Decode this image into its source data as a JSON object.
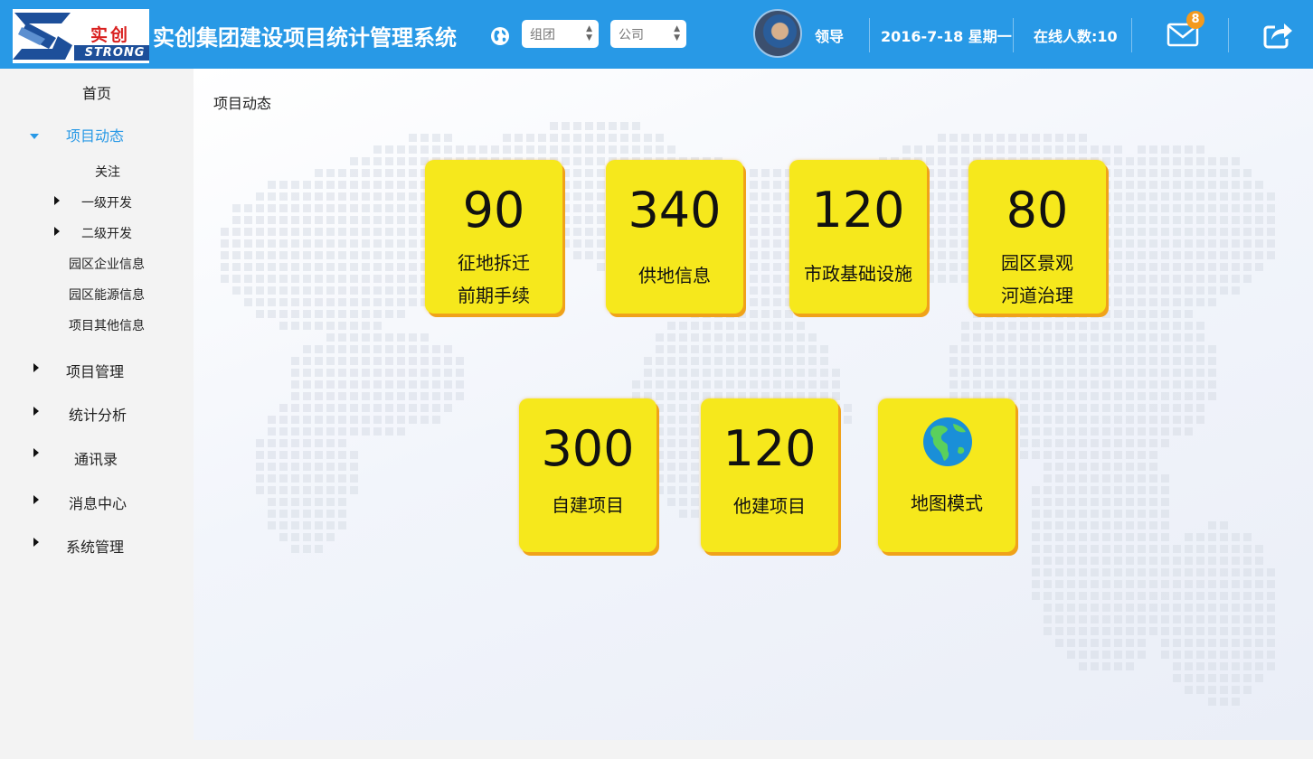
{
  "header": {
    "logo": {
      "cn": "实创",
      "en": "STRONG"
    },
    "title": "实创集团建设项目统计管理系统",
    "group_select": "组团",
    "company_select": "公司",
    "user_name": "领导",
    "date": "2016-7-18 星期一",
    "online_users": "在线人数:10",
    "message_count": "8"
  },
  "sidebar": {
    "home": "首页",
    "project_dynamics": "项目动态",
    "follow": "关注",
    "level1_dev": "一级开发",
    "level2_dev": "二级开发",
    "park_company_info": "园区企业信息",
    "park_energy_info": "园区能源信息",
    "project_other_info": "项目其他信息",
    "project_management": "项目管理",
    "statistical_analysis": "统计分析",
    "address_book": "通讯录",
    "message_center": "消息中心",
    "system_management": "系统管理"
  },
  "main": {
    "breadcrumb": "项目动态",
    "tiles": [
      {
        "value": "90",
        "line1": "征地拆迁",
        "line2": "前期手续"
      },
      {
        "value": "340",
        "line1": "供地信息"
      },
      {
        "value": "120",
        "line1": "市政基础设施"
      },
      {
        "value": "80",
        "line1": "园区景观",
        "line2": "河道治理"
      },
      {
        "value": "300",
        "line1": "自建项目"
      },
      {
        "value": "120",
        "line1": "他建项目"
      },
      {
        "line1": "地图模式"
      }
    ]
  },
  "colors": {
    "header": "#2899e6",
    "tile": "#f6e81c",
    "tile_shadow": "#f0a21a",
    "badge": "#f39a1d",
    "active_nav": "#2899e6"
  }
}
